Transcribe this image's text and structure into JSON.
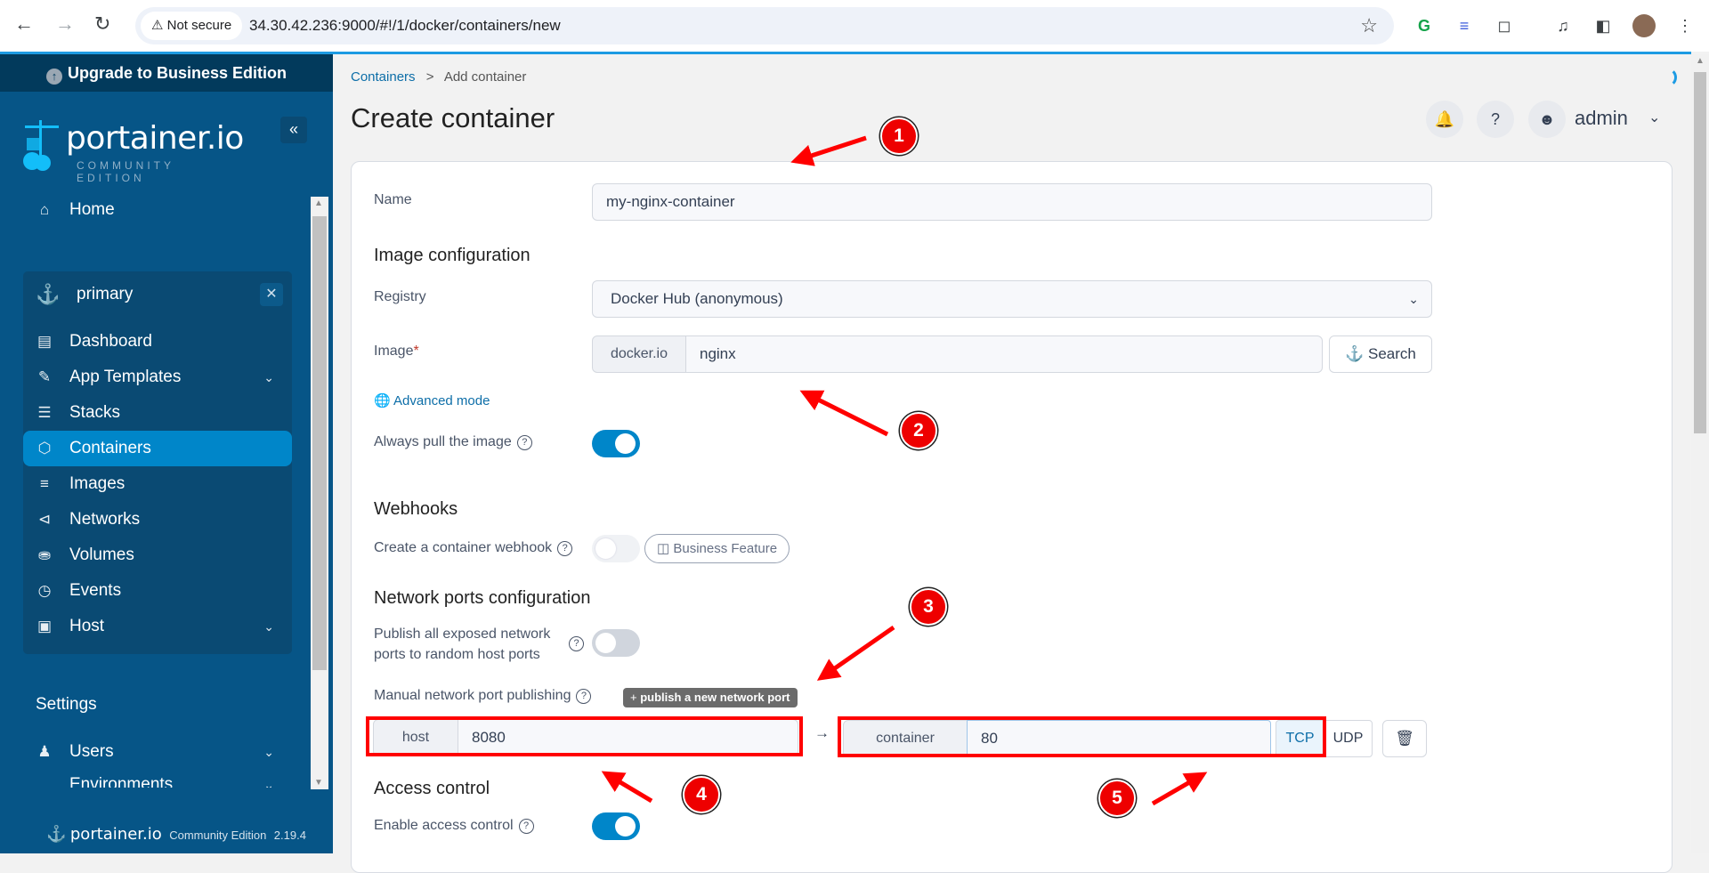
{
  "browser": {
    "security_label": "Not secure",
    "url": "34.30.42.236:9000/#!/1/docker/containers/new"
  },
  "sidebar": {
    "upgrade_label": "Upgrade to Business Edition",
    "logo_word": "portainer.io",
    "logo_edition": "COMMUNITY EDITION",
    "home_label": "Home",
    "environment": "primary",
    "items": [
      {
        "label": "Dashboard",
        "icon": "dashboard-icon"
      },
      {
        "label": "App Templates",
        "icon": "edit-icon",
        "expandable": true
      },
      {
        "label": "Stacks",
        "icon": "layers-icon"
      },
      {
        "label": "Containers",
        "icon": "box-icon",
        "active": true
      },
      {
        "label": "Images",
        "icon": "list-icon"
      },
      {
        "label": "Networks",
        "icon": "share-icon"
      },
      {
        "label": "Volumes",
        "icon": "database-icon"
      },
      {
        "label": "Events",
        "icon": "clock-icon"
      },
      {
        "label": "Host",
        "icon": "host-icon",
        "expandable": true
      }
    ],
    "settings_heading": "Settings",
    "settings_items": [
      {
        "label": "Users",
        "icon": "users-icon",
        "expandable": true
      },
      {
        "label": "Environments",
        "icon": "plug-icon",
        "expandable": true
      }
    ],
    "footer_word": "portainer.io",
    "footer_edition": "Community Edition",
    "footer_version": "2.19.4"
  },
  "header": {
    "breadcrumb_parent": "Containers",
    "breadcrumb_sep": ">",
    "breadcrumb_current": "Add container",
    "title": "Create container",
    "user": "admin"
  },
  "form": {
    "name_label": "Name",
    "name_value": "my-nginx-container",
    "image_config_heading": "Image configuration",
    "registry_label": "Registry",
    "registry_value": "Docker Hub (anonymous)",
    "image_label": "Image",
    "image_required_mark": "*",
    "image_prefix": "docker.io",
    "image_value": "nginx",
    "search_label": "Search",
    "advanced_mode_label": "Advanced mode",
    "always_pull_label": "Always pull the image",
    "always_pull": true,
    "webhooks_heading": "Webhooks",
    "webhook_label": "Create a container webhook",
    "webhook_enabled": false,
    "business_feature_label": "Business Feature",
    "network_heading": "Network ports configuration",
    "publish_all_label_1": "Publish all exposed network",
    "publish_all_label_2": "ports to random host ports",
    "publish_all": false,
    "manual_publish_label": "Manual network port publishing",
    "publish_new_label": "publish a new network port",
    "port_mapping": {
      "host_label": "host",
      "host_value": "8080",
      "container_label": "container",
      "container_value": "80",
      "protocols": [
        "TCP",
        "UDP"
      ],
      "selected_protocol": "TCP"
    },
    "access_heading": "Access control",
    "access_label": "Enable access control",
    "access_enabled": true
  },
  "annotations": [
    "1",
    "2",
    "3",
    "4",
    "5"
  ],
  "colors": {
    "sidebar_bg": "#065587",
    "sidebar_active": "#0086c9",
    "accent": "#0086c9",
    "annotation_red": "#ee0000"
  }
}
